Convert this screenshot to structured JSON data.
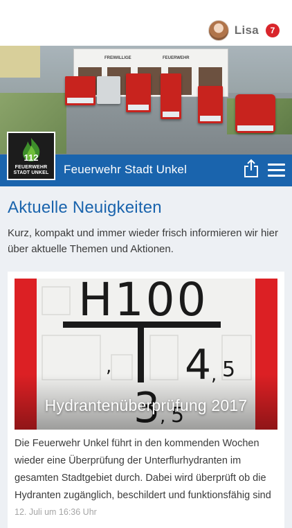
{
  "header": {
    "user_name": "Lisa",
    "notification_count": "7",
    "avatar_icon": "user-avatar-icon"
  },
  "station": {
    "name": "Feuerwehr Stadt Unkel",
    "logo": {
      "number": "112",
      "text_line1": "FEUERWEHR",
      "text_line2": "STADT UNKEL"
    },
    "hero_sign": {
      "left": "FREIWILLIGE",
      "right": "FEUERWEHR"
    },
    "share_icon": "share-icon",
    "menu_icon": "hamburger-menu-icon"
  },
  "news": {
    "title": "Aktuelle Neuigkeiten",
    "intro": "Kurz, kompakt und immer wieder frisch informieren wir hier über aktuelle Themen und Aktionen.",
    "articles": [
      {
        "title": "Hydrantenüberprüfung 2017",
        "excerpt": "Die Feuerwehr Unkel führt in den kommenden Wochen wieder eine Überprüfung der Unterflurhydranten im gesamten Stadtgebiet durch. Dabei wird überprüft ob die Hydranten zugänglich, beschildert und funktionsfähig sind",
        "date": "12. Juli um 16:36 Uhr",
        "image_sign": {
          "main": "H100",
          "right_value": "4",
          "right_sub": "5",
          "bottom_value": "3",
          "bottom_sub": "5"
        }
      }
    ]
  },
  "colors": {
    "brand_blue": "#1a64ad",
    "badge_red": "#d9252b",
    "sign_red": "#dc2024",
    "background": "#edf0f4"
  }
}
